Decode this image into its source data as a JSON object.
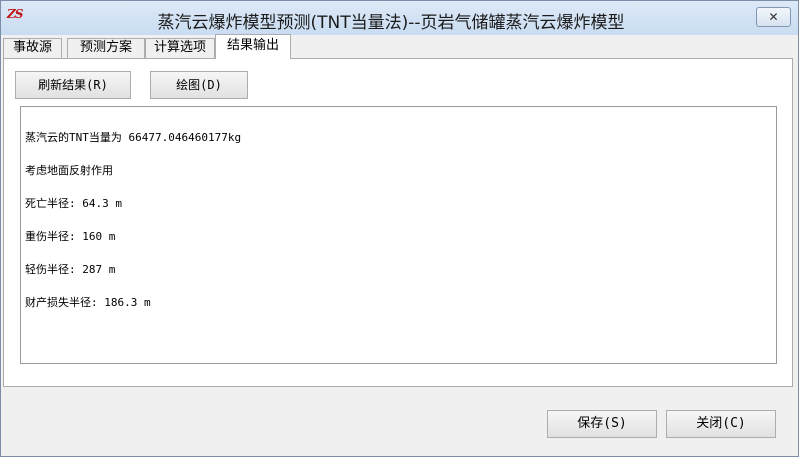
{
  "window": {
    "title": "蒸汽云爆炸模型预测(TNT当量法)--页岩气储罐蒸汽云爆炸模型",
    "app_icon": "ZS",
    "close_symbol": "✕"
  },
  "tabs": [
    {
      "label": "事故源",
      "active": false
    },
    {
      "label": "预测方案",
      "active": false
    },
    {
      "label": "计算选项",
      "active": false
    },
    {
      "label": "结果输出",
      "active": true
    }
  ],
  "panel": {
    "refresh_button": "刷新结果(R)",
    "plot_button": "绘图(D)",
    "results": [
      "蒸汽云的TNT当量为 66477.046460177kg",
      "考虑地面反射作用",
      "死亡半径: 64.3 m",
      "重伤半径: 160 m",
      "轻伤半径: 287 m",
      "财产损失半径: 186.3 m"
    ]
  },
  "footer": {
    "save_button": "保存(S)",
    "close_button": "关闭(C)"
  }
}
